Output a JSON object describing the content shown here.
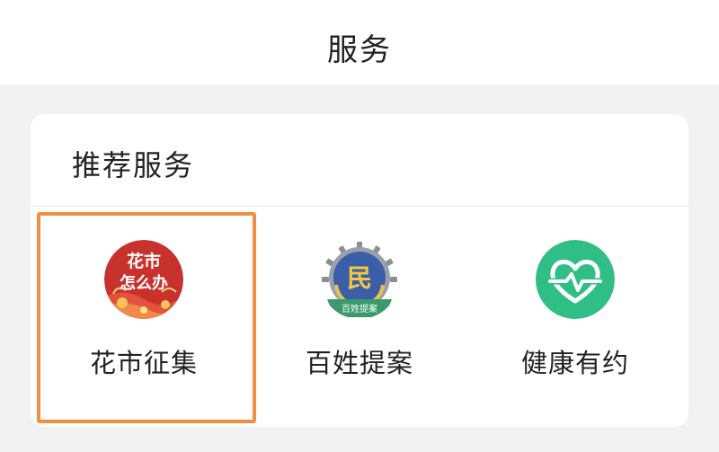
{
  "header": {
    "title": "服务"
  },
  "section": {
    "title": "推荐服务"
  },
  "services": [
    {
      "label": "花市征集",
      "icon": "huashi-zenmeban-icon",
      "icon_text_line1": "花市",
      "icon_text_line2": "怎么办"
    },
    {
      "label": "百姓提案",
      "icon": "baixing-tian-emblem-icon",
      "icon_glyph": "民",
      "icon_banner": "百姓提案"
    },
    {
      "label": "健康有约",
      "icon": "heart-pulse-icon"
    }
  ],
  "colors": {
    "highlight": "#ef8f43",
    "health_green": "#2fbf86",
    "red_badge": "#c8322c"
  }
}
